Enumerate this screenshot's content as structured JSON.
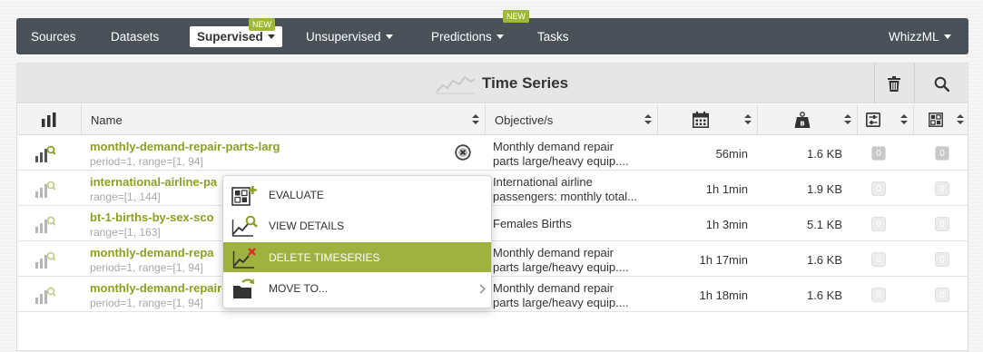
{
  "nav": {
    "sources": "Sources",
    "datasets": "Datasets",
    "supervised": "Supervised",
    "unsupervised": "Unsupervised",
    "predictions": "Predictions",
    "tasks": "Tasks",
    "whizzml": "WhizzML",
    "new_badge": "NEW"
  },
  "panel": {
    "title": "Time Series"
  },
  "columns": {
    "name": "Name",
    "objective": "Objective/s"
  },
  "rows": [
    {
      "name": "monthly-demand-repair-parts-larg",
      "params": "period=1, range=[1, 94]",
      "objective_1": "Monthly demand repair",
      "objective_2": "parts large/heavy equip....",
      "age": "56min",
      "size": "1.6 KB",
      "b1": "0",
      "b2": "0"
    },
    {
      "name": "international-airline-pa",
      "params": "range=[1, 144]",
      "objective_1": "International airline",
      "objective_2": "passengers: monthly total...",
      "age": "1h 1min",
      "size": "1.9 KB",
      "b1": "0",
      "b2": "0"
    },
    {
      "name": "bt-1-births-by-sex-sco",
      "params": "range=[1, 163]",
      "objective_1": "Females Births",
      "objective_2": "",
      "age": "1h 3min",
      "size": "5.1 KB",
      "b1": "0",
      "b2": "0"
    },
    {
      "name": "monthly-demand-repa",
      "params": "period=1, range=[1, 94]",
      "objective_1": "Monthly demand repair",
      "objective_2": "parts large/heavy equip....",
      "age": "1h 17min",
      "size": "1.6 KB",
      "b1": "0",
      "b2": "0"
    },
    {
      "name": "monthly-demand-repair-parts-larg",
      "params": "period=1, range=[1, 94]",
      "objective_1": "Monthly demand repair",
      "objective_2": "parts large/heavy equip....",
      "age": "1h 18min",
      "size": "1.6 KB",
      "b1": "0",
      "b2": "0"
    }
  ],
  "context_menu": {
    "evaluate": "EVALUATE",
    "view_details": "VIEW DETAILS",
    "delete": "DELETE TIMESERIES",
    "move_to": "MOVE TO..."
  },
  "colors": {
    "accent": "#9fb23f",
    "link": "#8aa022",
    "nav_bg": "#4a5158"
  }
}
